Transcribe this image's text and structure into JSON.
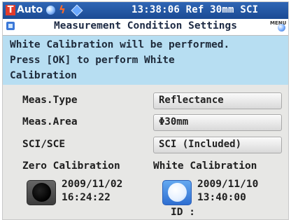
{
  "statusbar": {
    "mode_badge": "T",
    "mode": "Auto",
    "info": "13:38:06 Ref 30mm SCI",
    "icons": [
      "target-sphere-icon",
      "lightning-bolt-icon",
      "tag-icon"
    ]
  },
  "titlebar": {
    "title": "Measurement Condition Settings",
    "menu_label": "MENU"
  },
  "message": {
    "lines": [
      "White Calibration will be performed.",
      "Press [OK] to perform White",
      "Calibration"
    ]
  },
  "settings": [
    {
      "label": "Meas.Type",
      "value": "Reflectance"
    },
    {
      "label": "Meas.Area",
      "value": "Φ30mm"
    },
    {
      "label": "SCI/SCE",
      "value": "SCI (Included)"
    }
  ],
  "calibration": {
    "zero": {
      "title": "Zero Calibration",
      "date": "2009/11/02",
      "time": "16:24:22"
    },
    "white": {
      "title": "White Calibration",
      "date": "2009/11/10",
      "time": "13:40:00",
      "id_label": "ID :"
    }
  },
  "colors": {
    "status_bar": "#1f4f9c",
    "message_bg": "#b7def2",
    "panel_bg": "#e7e7e5",
    "white_cal_button": "#2e6ed1"
  }
}
